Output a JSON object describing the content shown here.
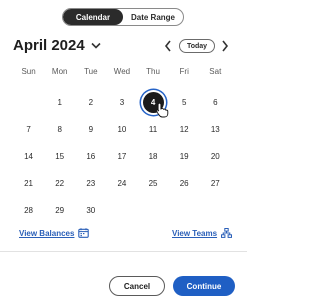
{
  "view_toggle": {
    "calendar_label": "Calendar",
    "date_range_label": "Date Range",
    "selected": "Calendar"
  },
  "header": {
    "month_label": "April 2024",
    "today_label": "Today"
  },
  "weekdays": [
    "Sun",
    "Mon",
    "Tue",
    "Wed",
    "Thu",
    "Fri",
    "Sat"
  ],
  "weeks": [
    [
      "",
      "1",
      "2",
      "3",
      "4",
      "5",
      "6"
    ],
    [
      "7",
      "8",
      "9",
      "10",
      "11",
      "12",
      "13"
    ],
    [
      "14",
      "15",
      "16",
      "17",
      "18",
      "19",
      "20"
    ],
    [
      "21",
      "22",
      "23",
      "24",
      "25",
      "26",
      "27"
    ],
    [
      "28",
      "29",
      "30",
      "",
      "",
      "",
      ""
    ]
  ],
  "selected_day": "4",
  "links": {
    "view_balances": "View Balances",
    "view_teams": "View Teams"
  },
  "footer": {
    "cancel_label": "Cancel",
    "continue_label": "Continue"
  },
  "colors": {
    "accent": "#1f5fc4",
    "link": "#2a5fb8",
    "selected_fill": "#1b1b1b",
    "selected_ring": "#2563c7"
  },
  "icons": {
    "month_dropdown": "chevron-down-icon",
    "prev": "chevron-left-icon",
    "next": "chevron-right-icon",
    "balances": "calendar-grid-icon",
    "teams": "org-chart-icon",
    "pointer": "hand-pointer-icon"
  }
}
